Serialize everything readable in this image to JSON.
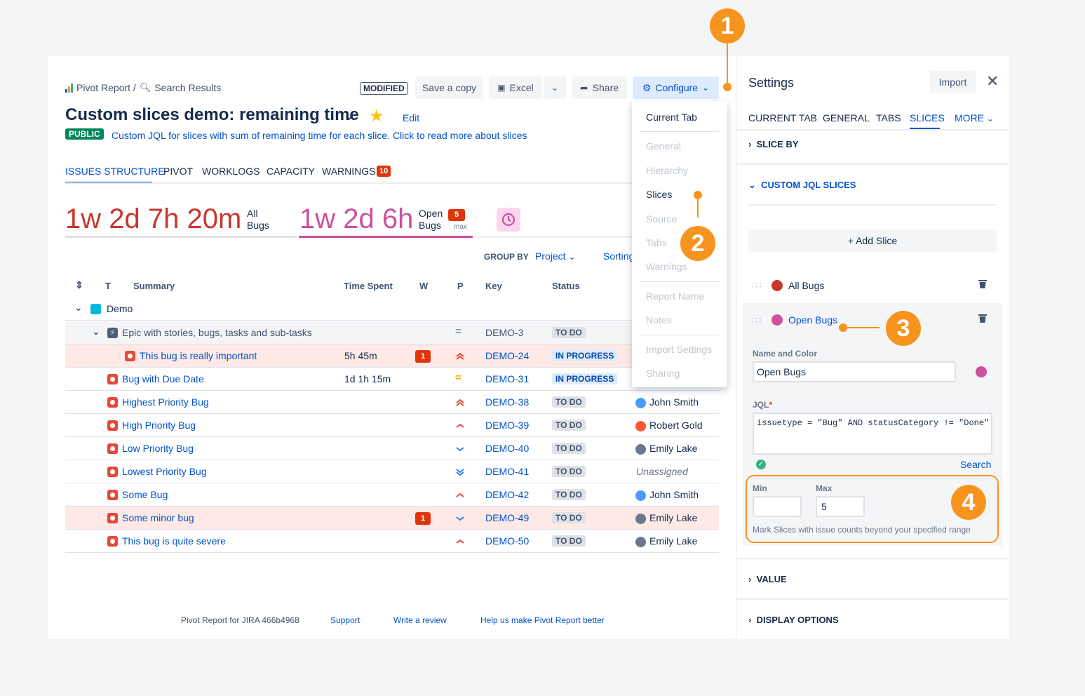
{
  "breadcrumb": {
    "app": "Pivot Report /",
    "page": "Search Results"
  },
  "toolbar": {
    "modified": "MODIFIED",
    "save_copy": "Save a copy",
    "excel": "Excel",
    "share": "Share",
    "configure": "Configure"
  },
  "report": {
    "title": "Custom slices demo: remaining time",
    "edit": "Edit",
    "badge": "PUBLIC",
    "description": "Custom JQL for slices with sum of remaining time for each slice. Click to read more about slices"
  },
  "tabs": {
    "issues": "ISSUES STRUCTURE",
    "pivot": "PIVOT",
    "worklogs": "WORKLOGS",
    "capacity": "CAPACITY",
    "warnings": "WARNINGS",
    "warnings_count": "10"
  },
  "slices_summary": {
    "all_value": "1w 2d 7h 20m",
    "all_label1": "All",
    "all_label2": "Bugs",
    "open_value": "1w 2d 6h",
    "open_label1": "Open",
    "open_label2": "Bugs",
    "open_badge": "5",
    "open_badge_sub": "max"
  },
  "groupby": {
    "label": "GROUP BY",
    "value": "Project",
    "sorting": "Sorting"
  },
  "table": {
    "headers": {
      "t": "T",
      "summary": "Summary",
      "time": "Time Spent",
      "w": "W",
      "p": "P",
      "key": "Key",
      "status": "Status"
    },
    "project": "Demo",
    "epic": {
      "summary": "Epic with stories, bugs, tasks and sub-tasks",
      "key": "DEMO-3",
      "status": "TO DO"
    },
    "rows": [
      {
        "summary": "This bug is really important",
        "time": "5h 45m",
        "w": "1",
        "prio": "highest",
        "key": "DEMO-24",
        "status": "IN PROGRESS",
        "assignee": ""
      },
      {
        "summary": "Bug with Due Date",
        "time": "1d 1h 15m",
        "w": "",
        "prio": "medium",
        "key": "DEMO-31",
        "status": "IN PROGRESS",
        "assignee": ""
      },
      {
        "summary": "Highest Priority Bug",
        "time": "",
        "w": "",
        "prio": "highest",
        "key": "DEMO-38",
        "status": "TO DO",
        "assignee": "John Smith"
      },
      {
        "summary": "High Priority Bug",
        "time": "",
        "w": "",
        "prio": "high",
        "key": "DEMO-39",
        "status": "TO DO",
        "assignee": "Robert Gold"
      },
      {
        "summary": "Low Priority Bug",
        "time": "",
        "w": "",
        "prio": "low",
        "key": "DEMO-40",
        "status": "TO DO",
        "assignee": "Emily Lake"
      },
      {
        "summary": "Lowest Priority Bug",
        "time": "",
        "w": "",
        "prio": "lowest",
        "key": "DEMO-41",
        "status": "TO DO",
        "assignee": "Unassigned"
      },
      {
        "summary": "Some Bug",
        "time": "",
        "w": "",
        "prio": "high",
        "key": "DEMO-42",
        "status": "TO DO",
        "assignee": "John Smith"
      },
      {
        "summary": "Some minor bug",
        "time": "",
        "w": "1",
        "prio": "low",
        "key": "DEMO-49",
        "status": "TO DO",
        "assignee": "Emily Lake"
      },
      {
        "summary": "This bug is quite severe",
        "time": "",
        "w": "",
        "prio": "high",
        "key": "DEMO-50",
        "status": "TO DO",
        "assignee": "Emily Lake"
      }
    ]
  },
  "menu": {
    "current_tab": "Current Tab",
    "general": "General",
    "hierarchy": "Hierarchy",
    "slices": "Slices",
    "source": "Source",
    "tabs": "Tabs",
    "warnings": "Warnings",
    "report_name": "Report Name",
    "notes": "Notes",
    "import_settings": "Import Settings",
    "sharing": "Sharing"
  },
  "footer": {
    "product": "Pivot Report for JIRA 466b4968",
    "support": "Support",
    "review": "Write a review",
    "help": "Help us make Pivot Report better"
  },
  "settings": {
    "title": "Settings",
    "import": "Import",
    "tabs": {
      "current": "CURRENT TAB",
      "general": "GENERAL",
      "tabs": "TABS",
      "slices": "SLICES",
      "more": "MORE"
    },
    "slice_by": "SLICE BY",
    "custom_jql": "CUSTOM JQL SLICES",
    "add_slice": "+ Add Slice",
    "slice1": "All Bugs",
    "slice2": "Open Bugs",
    "name_color_label": "Name and Color",
    "name_value": "Open Bugs",
    "jql_label": "JQL",
    "jql_value": "issuetype = \"Bug\" AND statusCategory != \"Done\"",
    "search": "Search",
    "min_label": "Min",
    "max_label": "Max",
    "min_value": "",
    "max_value": "5",
    "range_hint": "Mark Slices with issue counts beyond your specified range",
    "value": "VALUE",
    "display_options": "DISPLAY OPTIONS"
  },
  "callouts": {
    "c1": "1",
    "c2": "2",
    "c3": "3",
    "c4": "4"
  },
  "colors": {
    "accent": "#0052cc",
    "all_bugs": "#c9372c",
    "open_bugs": "#cd519d",
    "callout": "#f7941d"
  }
}
